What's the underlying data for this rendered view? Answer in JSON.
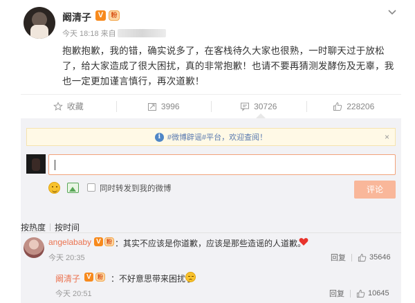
{
  "post": {
    "username": "阚清子",
    "v_badge": "V",
    "fan_badge": "粉",
    "time": "今天 18:18 来自",
    "text": "抱歉抱歉，我的错，确实说多了，在客栈待久大家也很熟，一时聊天过于放松了，给大家造成了很大困扰，真的非常抱歉！也请不要再猜测发酵伤及无辜，我也一定更加谨言慎行，再次道歉！"
  },
  "actions": {
    "favorite": "收藏",
    "repost": "3996",
    "comment": "30726",
    "like": "228206"
  },
  "comment_box": {
    "notice": "#微博辟谣#平台，欢迎查阅！",
    "close": "×",
    "repost_checkbox_label": "同时转发到我的微博",
    "submit": "评论"
  },
  "sort": {
    "hot": "按热度",
    "time": "按时间"
  },
  "comments": [
    {
      "user": "angelababy",
      "text": "：其实不应该是你道歉，应该是那些造谣的人道歉。",
      "time": "今天 20:35",
      "reply_label": "回复",
      "likes": "35646"
    }
  ],
  "reply": {
    "user": "阚清子",
    "text": "：不好意思带来困扰了",
    "time": "今天 20:51",
    "reply_label": "回复",
    "likes": "10645"
  },
  "colors": {
    "accent": "#eb7350",
    "link": "#eb7350",
    "submit_bg": "#f9b79a",
    "panel_bg": "#f2f2f5"
  }
}
